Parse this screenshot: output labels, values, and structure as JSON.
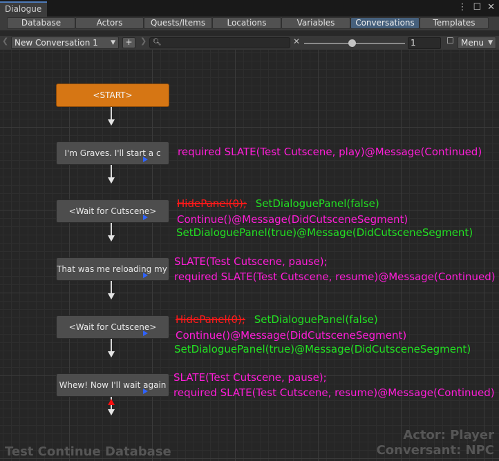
{
  "window": {
    "title": "Dialogue",
    "menu_glyph": "⋮",
    "maximize_glyph": "☐",
    "close_glyph": "✕"
  },
  "tabs": [
    "Database",
    "Actors",
    "Quests/Items",
    "Locations",
    "Variables",
    "Conversations",
    "Templates"
  ],
  "active_tab": "Conversations",
  "toolbar": {
    "conversation": "New Conversation 1",
    "add_label": "+",
    "search_value": "",
    "zoom_value": "1",
    "menu_label": "Menu"
  },
  "nodes": [
    {
      "text": "<START>"
    },
    {
      "text": "I'm Graves. I'll start a c"
    },
    {
      "text": "<Wait for Cutscene>"
    },
    {
      "text": "That was me reloading my r"
    },
    {
      "text": "<Wait for Cutscene>"
    },
    {
      "text": "Whew! Now I'll wait again"
    }
  ],
  "annotations": {
    "n1_line1": "required SLATE(Test Cutscene, play)@Message(Continued)",
    "n2_strike": "HidePanel(0);",
    "n2_line1": "SetDialoguePanel(false)",
    "n2_line2": "Continue()@Message(DidCutsceneSegment)",
    "n2_line3": "SetDialoguePanel(true)@Message(DidCutsceneSegment)",
    "n3_line1": "SLATE(Test Cutscene, pause);",
    "n3_line2": "required SLATE(Test Cutscene, resume)@Message(Continued)",
    "n4_strike": "HidePanel(0);",
    "n4_line1": "SetDialoguePanel(false)",
    "n4_line2": "Continue()@Message(DidCutsceneSegment)",
    "n4_line3": "SetDialoguePanel(true)@Message(DidCutsceneSegment)",
    "n5_line1": "SLATE(Test Cutscene, pause);",
    "n5_line2": "required SLATE(Test Cutscene, resume)@Message(Continued)"
  },
  "footer": {
    "database": "Test Continue Database",
    "actor": "Actor: Player",
    "conversant": "Conversant: NPC"
  },
  "colors": {
    "start_node": "#d67614",
    "active_tab": "#46607c",
    "annotation_magenta": "#ff1dd8",
    "annotation_green": "#22e022",
    "strike_red": "#ff1a1a"
  }
}
